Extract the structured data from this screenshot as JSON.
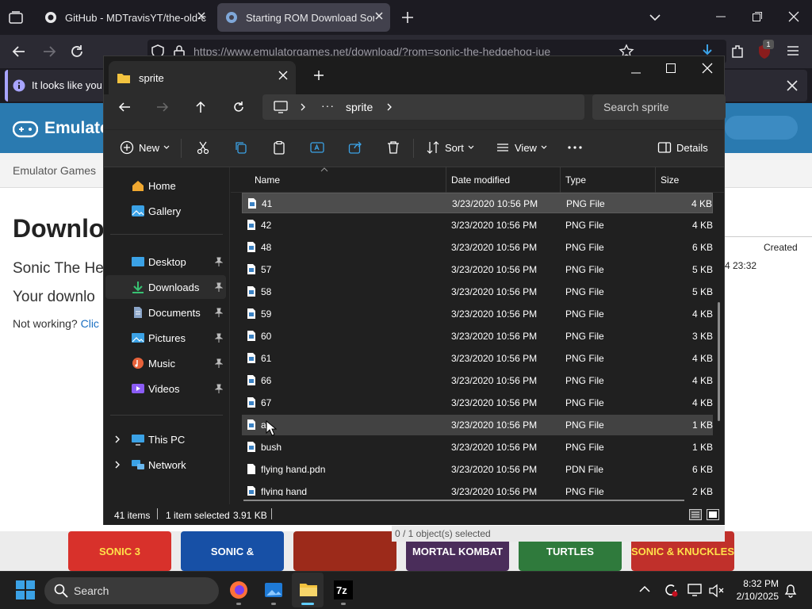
{
  "browser": {
    "tabs": [
      {
        "title": "GitHub - MDTravisYT/the-old-c",
        "icon": "github-icon"
      },
      {
        "title": "Starting ROM Download Sonic",
        "icon": "emulatorgames-icon",
        "active": true
      }
    ],
    "url": "https://www.emulatorgames.net/download/?rom=sonic-the-hedgehog-jue",
    "extension_badge": "1",
    "notification": "It looks like you h",
    "site_logo": "Emulato",
    "breadcrumb": "Emulator Games",
    "page_title": "Downlo",
    "subtitle": "Sonic The He",
    "status_line": "Your downlo",
    "not_working": "Not working?",
    "not_working_link": "Clic",
    "right_panel": {
      "created_header": "Created",
      "created_value": "4 23:32"
    },
    "game_covers": [
      "SONIC 3",
      "SONIC &",
      "",
      "MORTAL KOMBAT",
      "TURTLES",
      "SONIC & KNUCKLES"
    ],
    "objects_selected": "0 / 1 object(s) selected"
  },
  "explorer": {
    "title": "sprite",
    "address": {
      "crumb": "sprite",
      "ellipsis": "···"
    },
    "search_placeholder": "Search sprite",
    "toolbar": {
      "new": "New",
      "sort": "Sort",
      "view": "View",
      "details": "Details"
    },
    "sidebar": [
      {
        "label": "Home",
        "icon": "home-icon",
        "group": "top"
      },
      {
        "label": "Gallery",
        "icon": "gallery-icon",
        "group": "top"
      },
      {
        "label": "Desktop",
        "icon": "desktop-icon",
        "pinned": true
      },
      {
        "label": "Downloads",
        "icon": "download-icon",
        "pinned": true,
        "selected": true
      },
      {
        "label": "Documents",
        "icon": "documents-icon",
        "pinned": true
      },
      {
        "label": "Pictures",
        "icon": "pictures-icon",
        "pinned": true
      },
      {
        "label": "Music",
        "icon": "music-icon",
        "pinned": true
      },
      {
        "label": "Videos",
        "icon": "videos-icon",
        "pinned": true
      },
      {
        "label": "This PC",
        "icon": "computer-icon",
        "expandable": true
      },
      {
        "label": "Network",
        "icon": "network-icon",
        "expandable": true
      }
    ],
    "columns": {
      "name": "Name",
      "date": "Date modified",
      "type": "Type",
      "size": "Size"
    },
    "files": [
      {
        "name": "41",
        "date": "3/23/2020 10:56 PM",
        "type": "PNG File",
        "size": "4 KB"
      },
      {
        "name": "42",
        "date": "3/23/2020 10:56 PM",
        "type": "PNG File",
        "size": "4 KB"
      },
      {
        "name": "48",
        "date": "3/23/2020 10:56 PM",
        "type": "PNG File",
        "size": "6 KB"
      },
      {
        "name": "57",
        "date": "3/23/2020 10:56 PM",
        "type": "PNG File",
        "size": "5 KB"
      },
      {
        "name": "58",
        "date": "3/23/2020 10:56 PM",
        "type": "PNG File",
        "size": "5 KB"
      },
      {
        "name": "59",
        "date": "3/23/2020 10:56 PM",
        "type": "PNG File",
        "size": "4 KB"
      },
      {
        "name": "60",
        "date": "3/23/2020 10:56 PM",
        "type": "PNG File",
        "size": "3 KB"
      },
      {
        "name": "61",
        "date": "3/23/2020 10:56 PM",
        "type": "PNG File",
        "size": "4 KB"
      },
      {
        "name": "66",
        "date": "3/23/2020 10:56 PM",
        "type": "PNG File",
        "size": "4 KB"
      },
      {
        "name": "67",
        "date": "3/23/2020 10:56 PM",
        "type": "PNG File",
        "size": "4 KB"
      },
      {
        "name": "a",
        "date": "3/23/2020 10:56 PM",
        "type": "PNG File",
        "size": "1 KB"
      },
      {
        "name": "bush",
        "date": "3/23/2020 10:56 PM",
        "type": "PNG File",
        "size": "1 KB"
      },
      {
        "name": "flying hand.pdn",
        "date": "3/23/2020 10:56 PM",
        "type": "PDN File",
        "size": "6 KB"
      },
      {
        "name": "flying hand",
        "date": "3/23/2020 10:56 PM",
        "type": "PNG File",
        "size": "2 KB"
      }
    ],
    "status": {
      "items": "41 items",
      "selected": "1 item selected",
      "selected_size": "3.91 KB"
    }
  },
  "taskbar": {
    "search": "Search",
    "time": "8:32 PM",
    "date": "2/10/2025"
  },
  "colors": {
    "accent": "#0067c0",
    "site_header": "#2a7ab0",
    "downloads_icon": "#38c172",
    "badge": "#c50f1f"
  }
}
